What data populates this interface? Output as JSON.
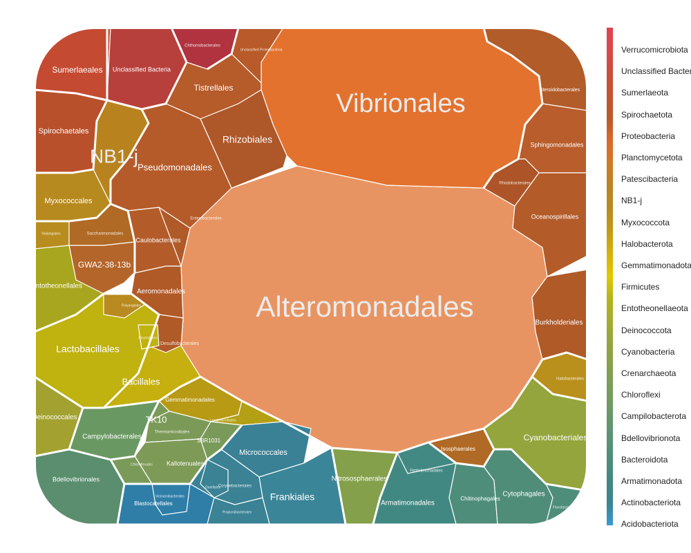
{
  "chart_data": {
    "type": "voronoi-treemap",
    "legend_position": "right",
    "legend": [
      {
        "name": "Verrucomicrobiota",
        "color": "#e0434f"
      },
      {
        "name": "Unclassified Bacteria",
        "color": "#d9484b"
      },
      {
        "name": "Sumerlaeota",
        "color": "#c94f3a"
      },
      {
        "name": "Spirochaetota",
        "color": "#c25530"
      },
      {
        "name": "Proteobacteria",
        "color": "#b85a29"
      },
      {
        "name": "Planctomycetota",
        "color": "#d96a2a"
      },
      {
        "name": "Patescibacteria",
        "color": "#cf7a25"
      },
      {
        "name": "NB1-j",
        "color": "#bb8424"
      },
      {
        "name": "Myxococcota",
        "color": "#b98a22"
      },
      {
        "name": "Halobacterota",
        "color": "#c29a16"
      },
      {
        "name": "Gemmatimonadota",
        "color": "#d4b20c"
      },
      {
        "name": "Firmicutes",
        "color": "#e3c900"
      },
      {
        "name": "Entotheonellaeota",
        "color": "#b3b41e"
      },
      {
        "name": "Deinococcota",
        "color": "#a5ab33"
      },
      {
        "name": "Cyanobacteria",
        "color": "#94a53f"
      },
      {
        "name": "Crenarchaeota",
        "color": "#85a04d"
      },
      {
        "name": "Chloroflexi",
        "color": "#779d5c"
      },
      {
        "name": "Campilobacterota",
        "color": "#6a9868"
      },
      {
        "name": "Bdellovibrionota",
        "color": "#5c9372"
      },
      {
        "name": "Bacteroidota",
        "color": "#4f8d7b"
      },
      {
        "name": "Armatimonadota",
        "color": "#438882"
      },
      {
        "name": "Actinobacteriota",
        "color": "#3a8492"
      },
      {
        "name": "Acidobacteriota",
        "color": "#3a9ad4"
      }
    ],
    "cells": [
      {
        "name": "Alteromonadales",
        "phylum": "Proteobacteria",
        "color": "#e89462"
      },
      {
        "name": "Vibrionales",
        "phylum": "Proteobacteria",
        "color": "#e3722e"
      },
      {
        "name": "Sumerlaeales",
        "phylum": "Sumerlaeota",
        "color": "#c44a32"
      },
      {
        "name": "Unclassified Bacteria",
        "phylum": "Unclassified Bacteria",
        "color": "#b8403c"
      },
      {
        "name": "Chthoniobacterales",
        "phylum": "Verrucomicrobiota",
        "color": "#b13340"
      },
      {
        "name": "Unclassified Proteobacteria",
        "phylum": "Proteobacteria",
        "color": "#b85a29"
      },
      {
        "name": "Tistrellales",
        "phylum": "Proteobacteria",
        "color": "#b65b2a"
      },
      {
        "name": "Rhizobiales",
        "phylum": "Proteobacteria",
        "color": "#ae5729"
      },
      {
        "name": "Pseudomonadales",
        "phylum": "Proteobacteria",
        "color": "#b55b2a"
      },
      {
        "name": "Spirochaetales",
        "phylum": "Spirochaetota",
        "color": "#b9502c"
      },
      {
        "name": "NB1-j",
        "phylum": "NB1-j",
        "color": "#b8831f"
      },
      {
        "name": "Myxococcales",
        "phylum": "Myxococcota",
        "color": "#b78a1f"
      },
      {
        "name": "Haliangiales",
        "phylum": "Myxococcota",
        "color": "#b88c1f"
      },
      {
        "name": "Saccharimonadales",
        "phylum": "Patescibacteria",
        "color": "#b06a25"
      },
      {
        "name": "GWA2-38-13b",
        "phylum": "Patescibacteria",
        "color": "#b4652a"
      },
      {
        "name": "Entotheonellales",
        "phylum": "Entotheonellaeota",
        "color": "#a8a61e"
      },
      {
        "name": "Enterobacterales",
        "phylum": "Proteobacteria",
        "color": "#b05a28"
      },
      {
        "name": "Caulobacterales",
        "phylum": "Proteobacteria",
        "color": "#b35c2a"
      },
      {
        "name": "Aeromonadales",
        "phylum": "Proteobacteria",
        "color": "#b05a28"
      },
      {
        "name": "Burkholderiales",
        "phylum": "Proteobacteria",
        "color": "#b05a28"
      },
      {
        "name": "Steroidobacterales",
        "phylum": "Proteobacteria",
        "color": "#b25c2a"
      },
      {
        "name": "Sphingomonadales",
        "phylum": "Proteobacteria",
        "color": "#b85d2b"
      },
      {
        "name": "Rhodobacterales",
        "phylum": "Proteobacteria",
        "color": "#ad5528"
      },
      {
        "name": "Oceanospirillales",
        "phylum": "Proteobacteria",
        "color": "#b35c2a"
      },
      {
        "name": "Halobacterales",
        "phylum": "Halobacterota",
        "color": "#b8901b"
      },
      {
        "name": "Lactobacillales",
        "phylum": "Firmicutes",
        "color": "#c0b20f"
      },
      {
        "name": "Bacillales",
        "phylum": "Firmicutes",
        "color": "#c5b00f"
      },
      {
        "name": "Gemmatimonadales",
        "phylum": "Gemmatimonadota",
        "color": "#b89a14"
      },
      {
        "name": "Longimicrobiales",
        "phylum": "Gemmatimonadota",
        "color": "#b3a015"
      },
      {
        "name": "Deinococcales",
        "phylum": "Deinococcota",
        "color": "#a3a231"
      },
      {
        "name": "Campylobacterales",
        "phylum": "Campilobacterota",
        "color": "#6a9862"
      },
      {
        "name": "TK10",
        "phylum": "Chloroflexi",
        "color": "#7c9a59"
      },
      {
        "name": "Thermomicrobiales",
        "phylum": "Chloroflexi",
        "color": "#7b9a58"
      },
      {
        "name": "Kallotenuales",
        "phylum": "Chloroflexi",
        "color": "#7e9a57"
      },
      {
        "name": "SBR1031",
        "phylum": "Chloroflexi",
        "color": "#7a9a5a"
      },
      {
        "name": "Bdellovibrionales",
        "phylum": "Bdellovibrionota",
        "color": "#5a8e6e"
      },
      {
        "name": "Blastocatellales",
        "phylum": "Acidobacteriota",
        "color": "#2e7ea8"
      },
      {
        "name": "Micrococcales",
        "phylum": "Actinobacteriota",
        "color": "#3a8196"
      },
      {
        "name": "Frankiales",
        "phylum": "Actinobacteriota",
        "color": "#3b8598"
      },
      {
        "name": "Propionibacteriales",
        "phylum": "Actinobacteriota",
        "color": "#3a8294"
      },
      {
        "name": "Corynebacteriales",
        "phylum": "Actinobacteriota",
        "color": "#3a8294"
      },
      {
        "name": "Nitrososphaerales",
        "phylum": "Crenarchaeota",
        "color": "#84a04b"
      },
      {
        "name": "Armatimonadales",
        "phylum": "Armatimonadota",
        "color": "#428882"
      },
      {
        "name": "Fimbriimonadales",
        "phylum": "Armatimonadota",
        "color": "#438983"
      },
      {
        "name": "Isosphaerales",
        "phylum": "Planctomycetota",
        "color": "#b06a25"
      },
      {
        "name": "Chitinophagales",
        "phylum": "Bacteroidota",
        "color": "#4f8d7b"
      },
      {
        "name": "Cytophagales",
        "phylum": "Bacteroidota",
        "color": "#4f8d79"
      },
      {
        "name": "Cyanobacteriales",
        "phylum": "Cyanobacteria",
        "color": "#93a53c"
      },
      {
        "name": "Flavobacteriales",
        "phylum": "Bacteroidota",
        "color": "#4f8d7b"
      },
      {
        "name": "Vicinamibacterales",
        "phylum": "Acidobacteriota",
        "color": "#2e7ea8"
      },
      {
        "name": "Gaiellales",
        "phylum": "Actinobacteriota",
        "color": "#3a8294"
      },
      {
        "name": "Chloroflexales",
        "phylum": "Chloroflexi",
        "color": "#7a9a5a"
      },
      {
        "name": "Polyangiales",
        "phylum": "Myxococcota",
        "color": "#b88a1f"
      },
      {
        "name": "Desulfobacterales",
        "phylum": "Proteobacteria",
        "color": "#b05a28"
      },
      {
        "name": "Clostridiales",
        "phylum": "Firmicutes",
        "color": "#c0b20f"
      }
    ]
  }
}
